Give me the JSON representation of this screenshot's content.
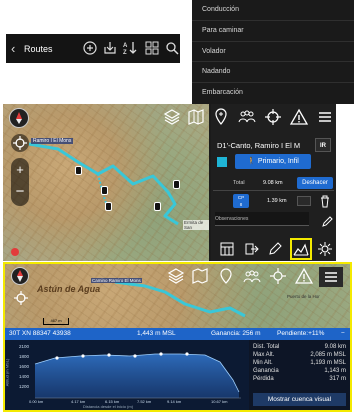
{
  "routes_bar": {
    "back_icon": "chevron-left-icon",
    "title": "Routes",
    "icons": [
      "add-circle-icon",
      "import-icon",
      "sort-az-icon",
      "grid-icon",
      "search-icon"
    ]
  },
  "dropdown": {
    "items": [
      "Conducción",
      "Para caminar",
      "Volador",
      "Nadando",
      "Embarcación"
    ]
  },
  "screen1": {
    "map_labels": {
      "start": "Ramiro I El Mons",
      "end": "Ermita de San"
    },
    "toolbar_icons": [
      "add-waypoint-icon",
      "group-icon",
      "target-icon",
      "warning-icon",
      "menu-icon"
    ],
    "route_name": "D1'-Canto, Ramiro I El M",
    "ir_label": "IR",
    "route_type": "Primario, Infil",
    "total_label": "Total",
    "total_value": "9.08 km",
    "undo_label": "Deshacer",
    "cp_label": "CP",
    "cp_number": "8",
    "cp_value": "1.39 km",
    "observaciones": "Observaciones",
    "bottom_icons": [
      "layers-icon",
      "export-icon",
      "edit-icon",
      "profile-icon",
      "settings-icon"
    ]
  },
  "screen2": {
    "map_labels": {
      "left": "Astún de Agua",
      "top": "Camino Ramiro El Mons",
      "right": "Puerto de la Hor"
    },
    "scale_label": "467 m",
    "coord": "30T XN 88347 43938",
    "elevation": "1,443 m MSL",
    "gain": "Ganancia: 256 m",
    "slope": "Pendiente:+11%",
    "y_labels": [
      "2100",
      "1800",
      "1600",
      "1400",
      "1200"
    ],
    "x_labels": [
      "0.00 km",
      "4.17 km",
      "6.15 km",
      "7.52 km",
      "9.14 km",
      "10.67 km"
    ],
    "x_axis_label": "Distancia desde el inicio (m)",
    "y_axis_label": "Altitud (m MSL)",
    "stats": [
      {
        "label": "Dist. Total",
        "value": "9.08 km"
      },
      {
        "label": "Max Alt.",
        "value": "2,085 m MSL"
      },
      {
        "label": "Min Alt.",
        "value": "1,193 m MSL"
      },
      {
        "label": "Ganancia",
        "value": "1,143 m"
      },
      {
        "label": "Pérdida",
        "value": "317 m"
      }
    ],
    "show_basin": "Mostrar cuenca visual",
    "colors": {
      "highlight_border": "#f4ea00",
      "accent": "#1e64c8",
      "route": "#39c7d8"
    }
  }
}
